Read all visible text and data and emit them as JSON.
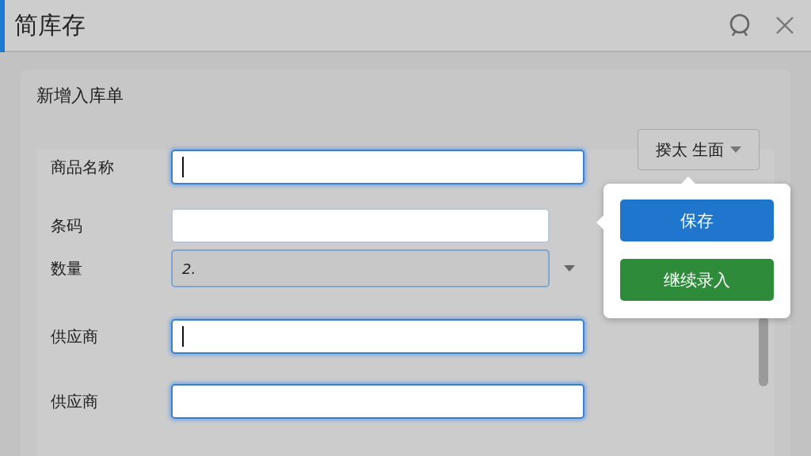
{
  "app": {
    "title": "简库存"
  },
  "form": {
    "title": "新增入库单",
    "fields": [
      {
        "label": "商品名称",
        "kind": "text",
        "focused": true,
        "caret": true
      },
      {
        "label": "条码",
        "kind": "text",
        "focused": false
      },
      {
        "label": "数量",
        "kind": "select",
        "value": "2.",
        "focused": false
      },
      {
        "label": "供应商",
        "kind": "text",
        "focused": true,
        "caret": true
      },
      {
        "label": "供应商",
        "kind": "text",
        "focused": true
      }
    ],
    "dropdown": {
      "label": "揆太 生面"
    }
  },
  "popover": {
    "buttons": [
      {
        "label": "保存",
        "kind": "primary"
      },
      {
        "label": "继续录入",
        "kind": "success"
      }
    ]
  }
}
